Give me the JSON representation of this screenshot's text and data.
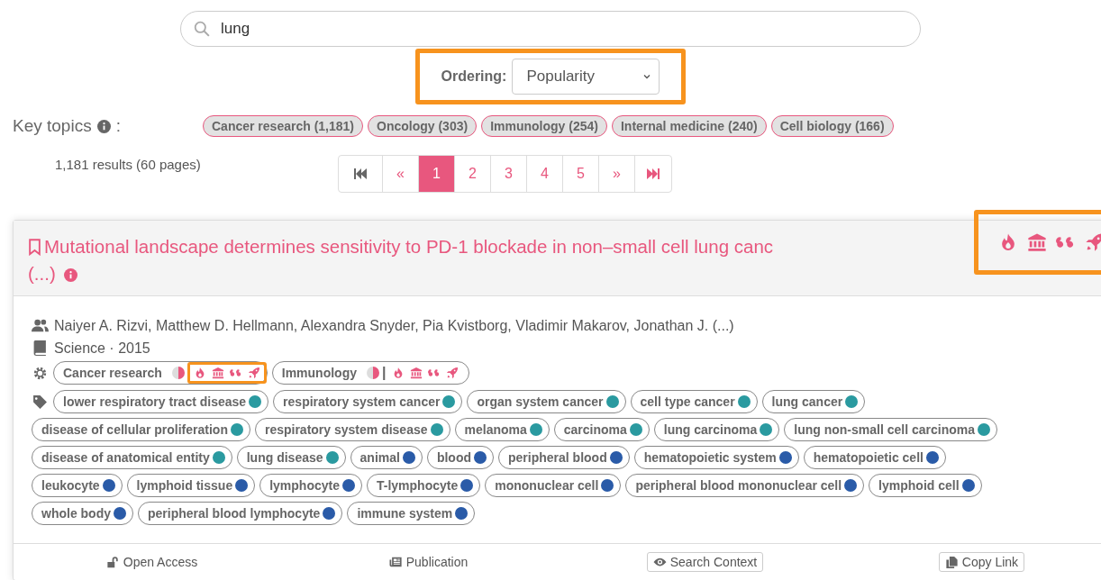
{
  "search": {
    "value": "lung"
  },
  "ordering": {
    "label": "Ordering:",
    "value": "Popularity"
  },
  "key_topics": {
    "label": "Key topics",
    "label_suffix": ":",
    "topics": [
      "Cancer research (1,181)",
      "Oncology (303)",
      "Immunology (254)",
      "Internal medicine (240)",
      "Cell biology (166)"
    ]
  },
  "results_count": "1,181 results (60 pages)",
  "pagination": [
    {
      "label": "«",
      "selected": false
    },
    {
      "label": "1",
      "selected": true
    },
    {
      "label": "2",
      "selected": false
    },
    {
      "label": "3",
      "selected": false
    },
    {
      "label": "4",
      "selected": false
    },
    {
      "label": "5",
      "selected": false
    },
    {
      "label": "»",
      "selected": false
    }
  ],
  "result": {
    "title": "Mutational landscape determines sensitivity to PD-1 blockade in non–small cell lung canc",
    "title_more": "(...)",
    "authors": "Naiyer A. Rizvi, Matthew D. Hellmann, Alexandra Snyder, Pia Kvistborg, Vladimir Makarov, Jonathan J. (...)",
    "venue": "Science · 2015",
    "fields": [
      {
        "name": "Cancer research"
      },
      {
        "name": "Immunology",
        "separator": "|"
      }
    ],
    "concepts": [
      {
        "name": "lower respiratory tract disease",
        "color": "#2a9aa0"
      },
      {
        "name": "respiratory system cancer",
        "color": "#2a9aa0"
      },
      {
        "name": "organ system cancer",
        "color": "#2a9aa0"
      },
      {
        "name": "cell type cancer",
        "color": "#2a9aa0"
      },
      {
        "name": "lung cancer",
        "color": "#2a9aa0"
      },
      {
        "name": "disease of cellular proliferation",
        "color": "#2a9aa0"
      },
      {
        "name": "respiratory system disease",
        "color": "#2a9aa0"
      },
      {
        "name": "melanoma",
        "color": "#2a9aa0"
      },
      {
        "name": "carcinoma",
        "color": "#2a9aa0"
      },
      {
        "name": "lung carcinoma",
        "color": "#2a9aa0"
      },
      {
        "name": "lung non-small cell carcinoma",
        "color": "#2a9aa0"
      },
      {
        "name": "disease of anatomical entity",
        "color": "#2a9aa0"
      },
      {
        "name": "lung disease",
        "color": "#2a9aa0"
      },
      {
        "name": "animal",
        "color": "#2a5ba8"
      },
      {
        "name": "blood",
        "color": "#2a5ba8"
      },
      {
        "name": "peripheral blood",
        "color": "#2a5ba8"
      },
      {
        "name": "hematopoietic system",
        "color": "#2a5ba8"
      },
      {
        "name": "hematopoietic cell",
        "color": "#2a5ba8"
      },
      {
        "name": "leukocyte",
        "color": "#2a5ba8"
      },
      {
        "name": "lymphoid tissue",
        "color": "#2a5ba8"
      },
      {
        "name": "lymphocyte",
        "color": "#2a5ba8"
      },
      {
        "name": "T-lymphocyte",
        "color": "#2a5ba8"
      },
      {
        "name": "mononuclear cell",
        "color": "#2a5ba8"
      },
      {
        "name": "peripheral blood mononuclear cell",
        "color": "#2a5ba8"
      },
      {
        "name": "lymphoid cell",
        "color": "#2a5ba8"
      },
      {
        "name": "whole body",
        "color": "#2a5ba8"
      },
      {
        "name": "peripheral blood lymphocyte",
        "color": "#2a5ba8"
      },
      {
        "name": "immune system",
        "color": "#2a5ba8"
      }
    ],
    "actions": [
      {
        "label": "Open Access",
        "kind": "open-access"
      },
      {
        "label": "Publication",
        "kind": "publication"
      },
      {
        "label": "Search Context",
        "kind": "search-context"
      },
      {
        "label": "Copy Link",
        "kind": "copy-link"
      }
    ]
  }
}
